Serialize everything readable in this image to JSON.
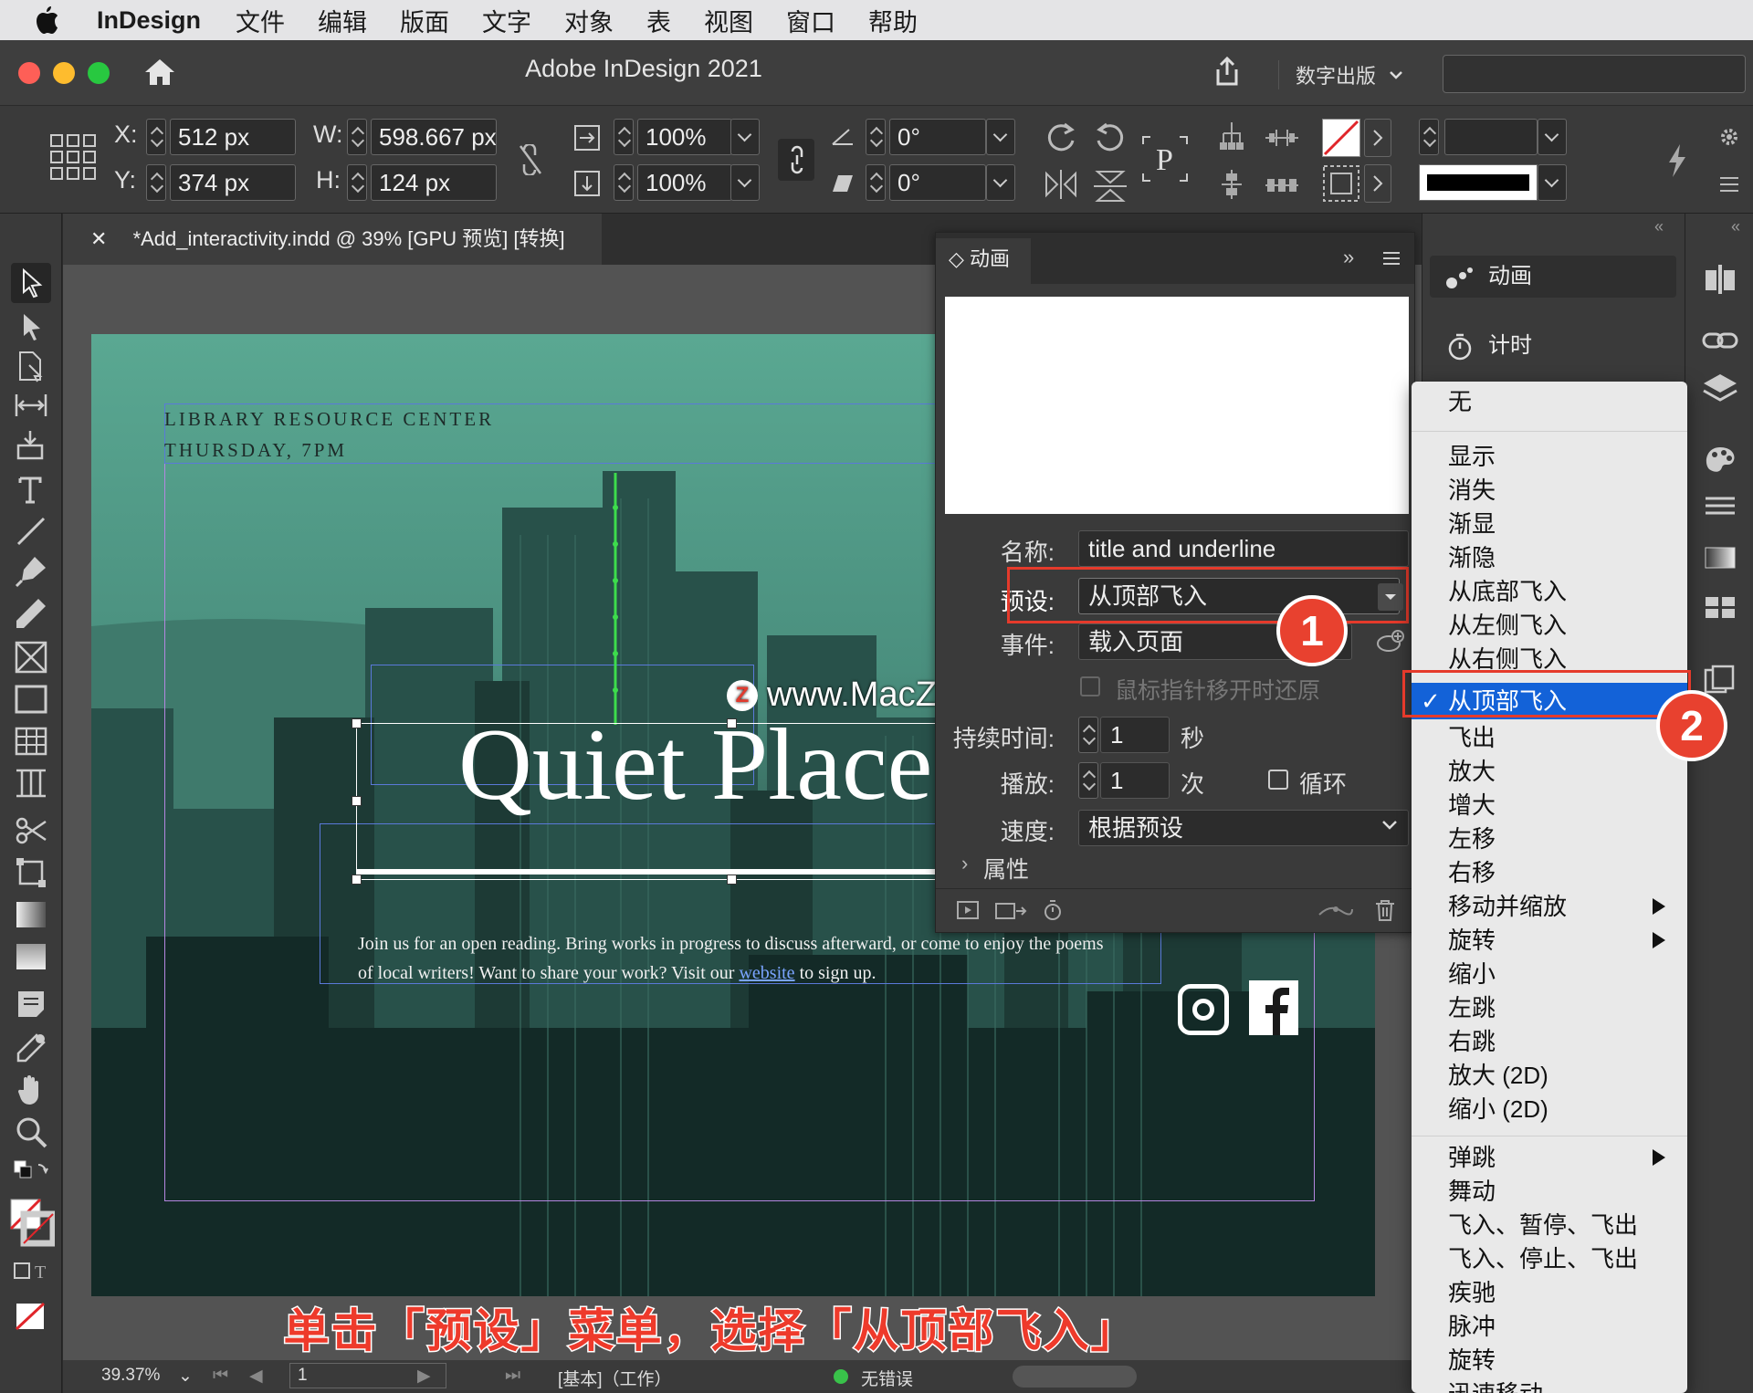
{
  "menubar": {
    "app": "InDesign",
    "items": [
      "文件",
      "编辑",
      "版面",
      "文字",
      "对象",
      "表",
      "视图",
      "窗口",
      "帮助"
    ]
  },
  "titlebar": {
    "title": "Adobe InDesign 2021",
    "workspace": "数字出版"
  },
  "controlbar": {
    "x_label": "X:",
    "x_value": "512 px",
    "y_label": "Y:",
    "y_value": "374 px",
    "w_label": "W:",
    "w_value": "598.667 px",
    "h_label": "H:",
    "h_value": "124 px",
    "scale_x": "100%",
    "scale_y": "100%",
    "rotate": "0°",
    "shear": "0°"
  },
  "document": {
    "tab_title": "*Add_interactivity.indd @ 39% [GPU 预览] [转换]",
    "header_line1": "LIBRARY RESOURCE CENTER",
    "header_line2": "THURSDAY, 7PM",
    "headline": "Quiet Place",
    "body_part1": "Join us for an open reading. Bring works in progress to discuss afterward, or come to enjoy the poems of local writers! Want to share your work? Visit our ",
    "body_link": "website",
    "body_part2": " to sign up."
  },
  "watermark": {
    "text": "www.MacZ.com",
    "icon_letter": "Z"
  },
  "caption": "单击「预设」菜单，选择「从顶部飞入」",
  "animation_panel": {
    "tab_label": "动画",
    "name_label": "名称:",
    "name_value": "title and underline",
    "preset_label": "预设:",
    "preset_value": "从顶部飞入",
    "event_label": "事件:",
    "event_value": "载入页面",
    "revert_label": "鼠标指针移开时还原",
    "duration_label": "持续时间:",
    "duration_value": "1",
    "duration_unit": "秒",
    "play_label": "播放:",
    "play_value": "1",
    "play_unit": "次",
    "loop_label": "循环",
    "speed_label": "速度:",
    "speed_value": "根据预设",
    "properties_label": "属性"
  },
  "badges": {
    "one": "1",
    "two": "2"
  },
  "right_panel": {
    "animation_label": "动画",
    "timing_label": "计时"
  },
  "preset_menu": {
    "none": "无",
    "group1": [
      "显示",
      "消失",
      "渐显",
      "渐隐",
      "从底部飞入",
      "从左侧飞入",
      "从右侧飞入"
    ],
    "selected": "从顶部飞入",
    "group2": [
      "飞出",
      "放大",
      "增大",
      "左移",
      "右移",
      "移动并缩放",
      "旋转",
      "缩小",
      "左跳",
      "右跳",
      "放大 (2D)",
      "缩小 (2D)"
    ],
    "group3": [
      "弹跳",
      "舞动",
      "飞入、暂停、飞出",
      "飞入、停止、飞出",
      "疾驰",
      "脉冲",
      "旋转",
      "迅速移动"
    ]
  },
  "statusbar": {
    "zoom": "39.37%",
    "page": "1",
    "mode": "[基本]（工作）",
    "errors": "无错误"
  },
  "colors": {
    "accent_red": "#e53a2b",
    "menu_selection": "#1362d8",
    "page_tint": "#5aa892",
    "status_ok": "#39c24a"
  }
}
